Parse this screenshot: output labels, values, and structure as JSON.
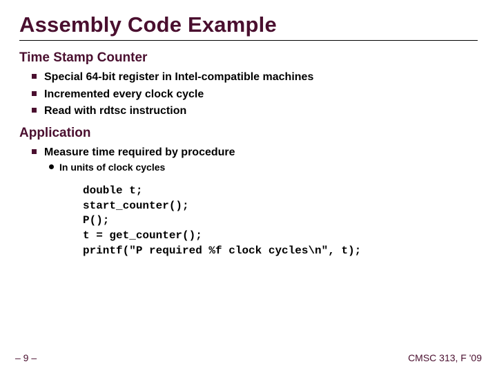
{
  "title": "Assembly Code Example",
  "sections": [
    {
      "heading": "Time Stamp Counter",
      "bullets": [
        {
          "text": "Special 64-bit register in Intel-compatible machines"
        },
        {
          "text": "Incremented every clock cycle"
        },
        {
          "text": "Read with rdtsc instruction"
        }
      ]
    },
    {
      "heading": "Application",
      "bullets": [
        {
          "text": "Measure time required by procedure",
          "sub": [
            {
              "text": "In units of clock cycles"
            }
          ]
        }
      ]
    }
  ],
  "code": "double t;\nstart_counter();\nP();\nt = get_counter();\nprintf(\"P required %f clock cycles\\n\", t);",
  "footer": {
    "left": "– 9 –",
    "right": "CMSC 313, F '09"
  }
}
